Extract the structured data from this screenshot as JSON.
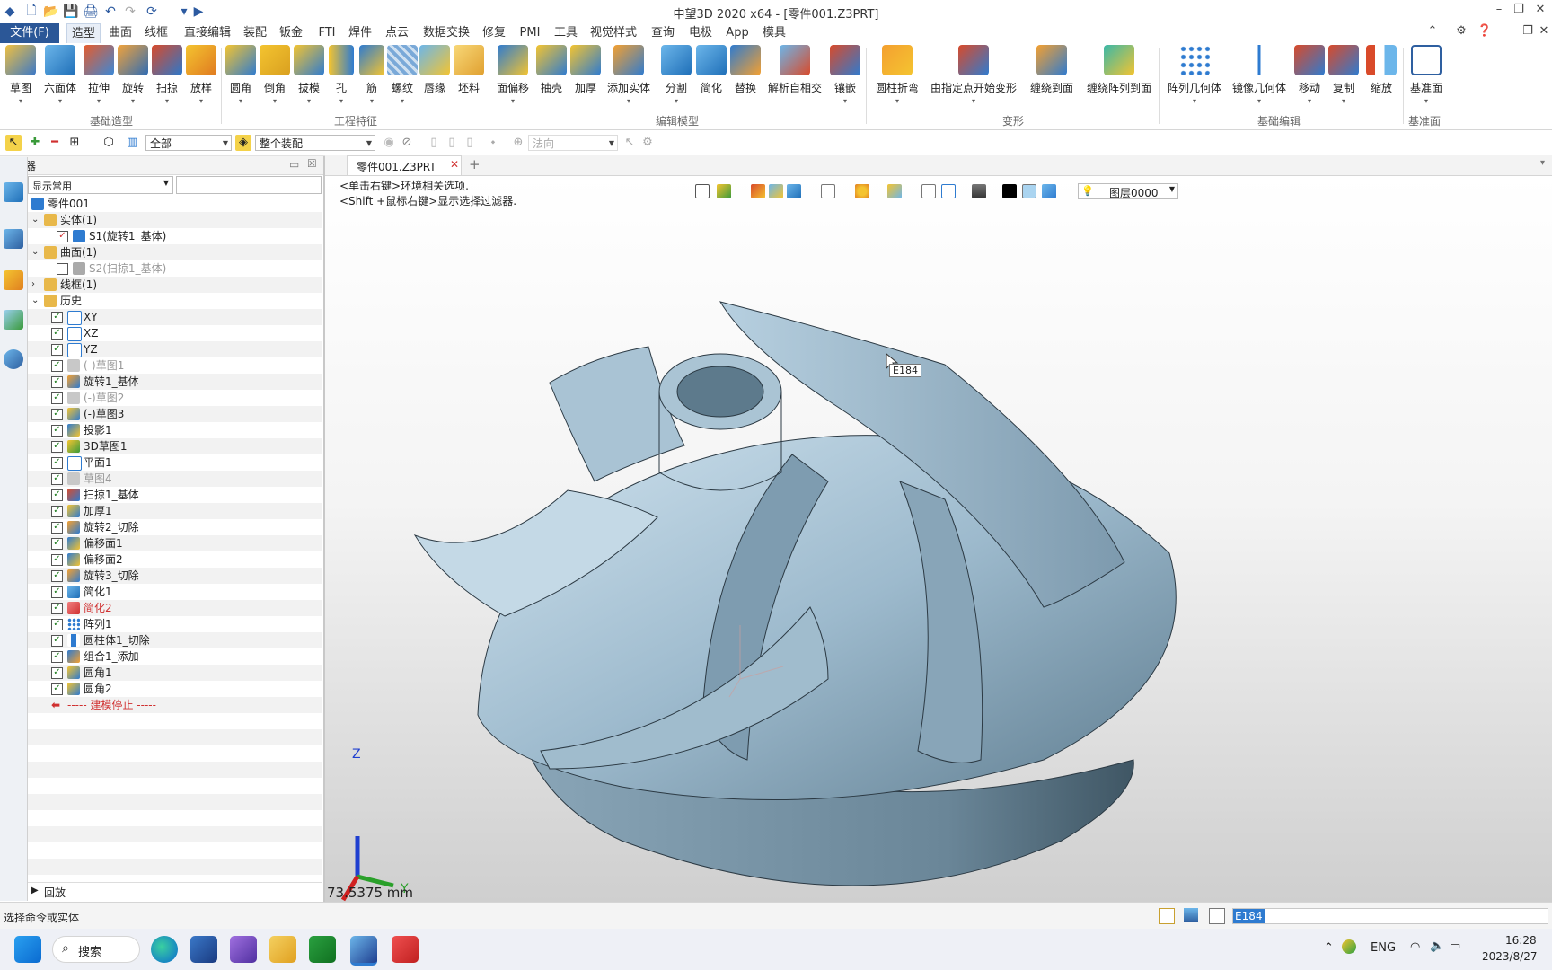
{
  "window": {
    "title": "中望3D 2020 x64 - [零件001.Z3PRT]"
  },
  "menu": [
    "文件(F)",
    "造型",
    "曲面",
    "线框",
    "直接编辑",
    "装配",
    "钣金",
    "FTI",
    "焊件",
    "点云",
    "数据交换",
    "修复",
    "PMI",
    "工具",
    "视觉样式",
    "查询",
    "电极",
    "App",
    "模具"
  ],
  "ribbon": {
    "buttons": [
      "草图",
      "六面体",
      "拉伸",
      "旋转",
      "扫掠",
      "放样",
      "圆角",
      "倒角",
      "拔模",
      "孔",
      "筋",
      "螺纹",
      "唇缘",
      "坯料",
      "面偏移",
      "抽壳",
      "加厚",
      "添加实体",
      "分割",
      "简化",
      "替换",
      "解析自相交",
      "镶嵌",
      "圆柱折弯",
      "由指定点开始变形",
      "缠绕到面",
      "缠绕阵列到面",
      "阵列几何体",
      "镜像几何体",
      "移动",
      "复制",
      "缩放",
      "基准面"
    ],
    "groups": [
      "基础造型",
      "工程特征",
      "编辑模型",
      "变形",
      "基础编辑",
      "基准面"
    ]
  },
  "toolbar2": {
    "filter": "全部",
    "assembly": "整个装配",
    "direction": "法向"
  },
  "manager": {
    "title": "管理器",
    "filter": "显示常用",
    "tree": [
      {
        "label": "零件001"
      },
      {
        "label": "实体(1)"
      },
      {
        "label": "S1(旋转1_基体)"
      },
      {
        "label": "曲面(1)"
      },
      {
        "label": "S2(扫掠1_基体)"
      },
      {
        "label": "线框(1)"
      },
      {
        "label": "历史"
      },
      {
        "label": "XY"
      },
      {
        "label": "XZ"
      },
      {
        "label": "YZ"
      },
      {
        "label": "(-)草图1"
      },
      {
        "label": "旋转1_基体"
      },
      {
        "label": "(-)草图2"
      },
      {
        "label": "(-)草图3"
      },
      {
        "label": "投影1"
      },
      {
        "label": "3D草图1"
      },
      {
        "label": "平面1"
      },
      {
        "label": "草图4"
      },
      {
        "label": "扫掠1_基体"
      },
      {
        "label": "加厚1"
      },
      {
        "label": "旋转2_切除"
      },
      {
        "label": "偏移面1"
      },
      {
        "label": "偏移面2"
      },
      {
        "label": "旋转3_切除"
      },
      {
        "label": "简化1"
      },
      {
        "label": "简化2"
      },
      {
        "label": "阵列1"
      },
      {
        "label": "圆柱体1_切除"
      },
      {
        "label": "组合1_添加"
      },
      {
        "label": "圆角1"
      },
      {
        "label": "圆角2"
      },
      {
        "label": "----- 建模停止 -----"
      }
    ],
    "playback": "回放"
  },
  "viewport": {
    "tab": "零件001.Z3PRT",
    "hints": [
      "<单击右键>环境相关选项.",
      "<Shift +鼠标右键>显示选择过滤器."
    ],
    "layer": "图层0000",
    "tooltip": "E184",
    "scale": "73.5375 mm",
    "axes": {
      "z": "Z",
      "y": "Y"
    }
  },
  "status": {
    "left": "选择命令或实体",
    "entity": "E184"
  },
  "taskbar": {
    "search": "搜索",
    "lang": "ENG",
    "time": "16:28",
    "date": "2023/8/27"
  },
  "colors": {
    "accent": "#2b5797",
    "part": "#9bb8cc"
  }
}
